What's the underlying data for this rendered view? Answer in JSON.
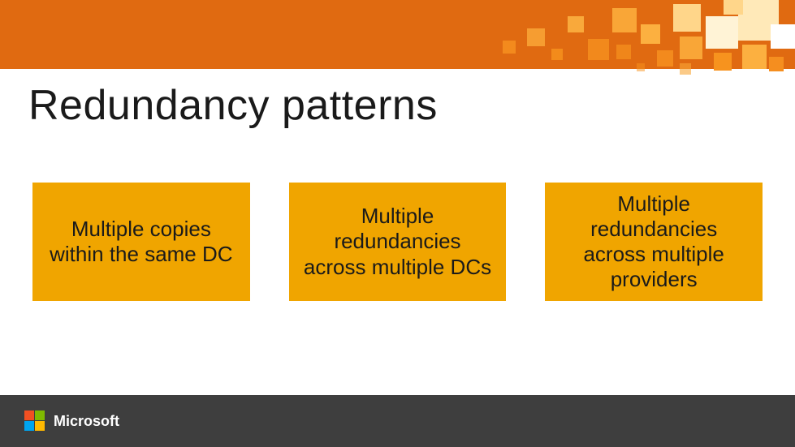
{
  "slide": {
    "title": "Redundancy patterns",
    "boxes": [
      {
        "label": "Multiple copies within the same DC"
      },
      {
        "label": "Multiple redundancies across multiple DCs"
      },
      {
        "label": "Multiple redundancies across multiple providers"
      }
    ],
    "footer": {
      "brand": "Microsoft"
    }
  }
}
